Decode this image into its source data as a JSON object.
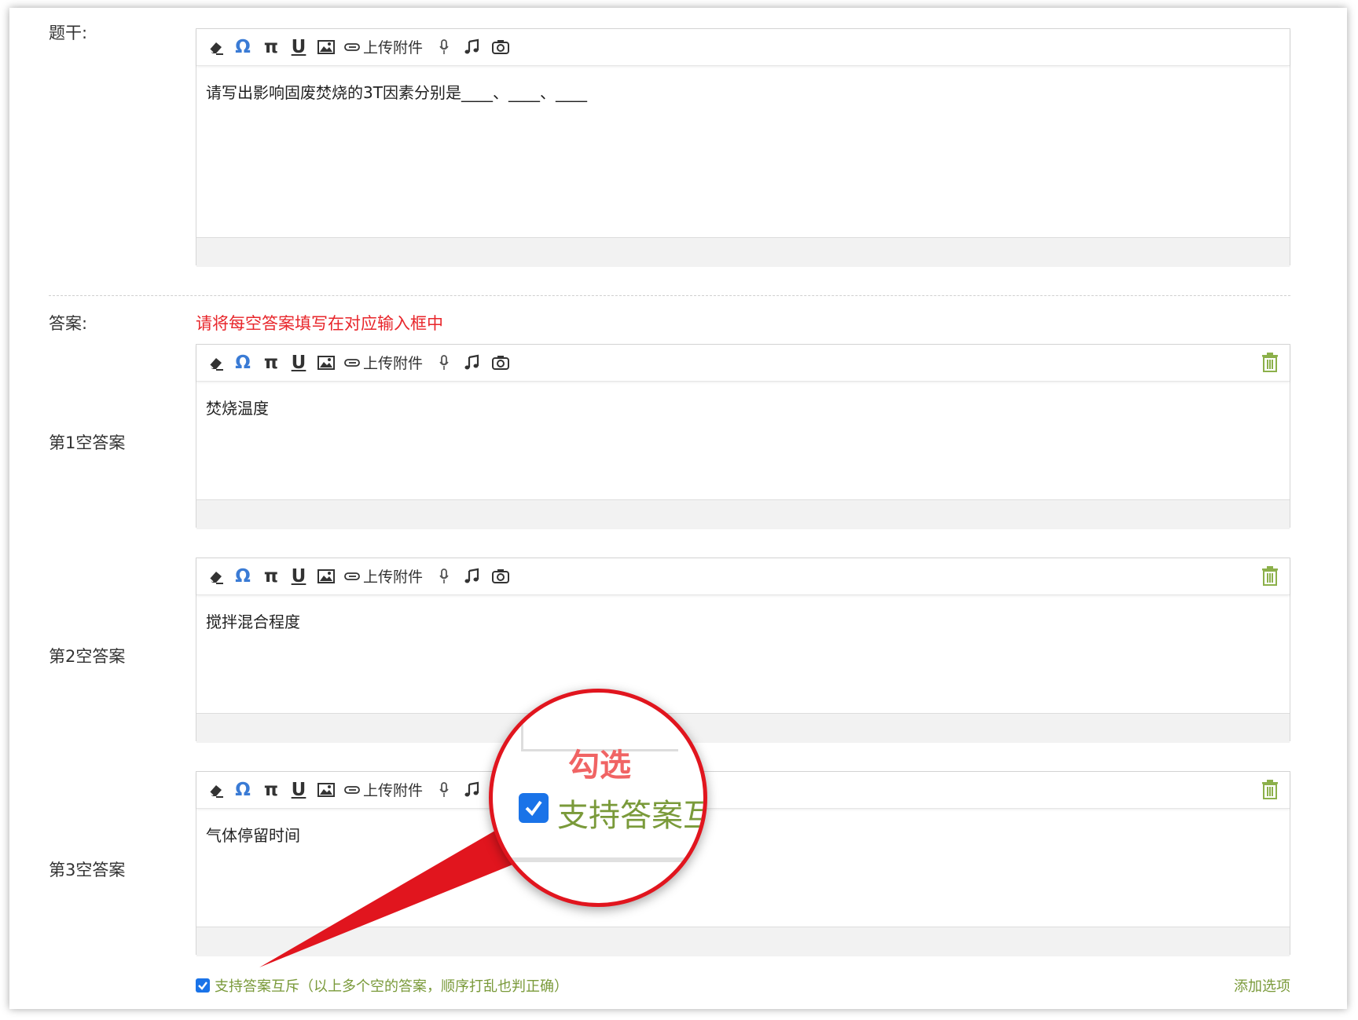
{
  "stem": {
    "label": "题干:",
    "content": "请写出影响固废焚烧的3T因素分别是____、____、____"
  },
  "toolbar": {
    "upload_label": "上传附件",
    "icons": [
      "eraser-icon",
      "omega-icon",
      "pi-icon",
      "underline-icon",
      "image-icon",
      "paperclip-icon",
      "microphone-icon",
      "music-note-icon",
      "camera-icon"
    ],
    "omega_glyph": "Ω",
    "pi_glyph": "π",
    "underline_glyph": "U"
  },
  "answer": {
    "label": "答案:",
    "hint": "请将每空答案填写在对应输入框中",
    "blanks": [
      {
        "label": "第1空答案",
        "content": "焚烧温度"
      },
      {
        "label": "第2空答案",
        "content": "搅拌混合程度"
      },
      {
        "label": "第3空答案",
        "content": "气体停留时间"
      }
    ]
  },
  "footer": {
    "mutual_exclusive_label": "支持答案互斥（以上多个空的答案，顺序打乱也判正确）",
    "mutual_exclusive_checked": true,
    "add_option_label": "添加选项"
  },
  "callout": {
    "title": "勾选",
    "text": "支持答案互",
    "accent_color": "#e1151e"
  },
  "colors": {
    "hint": "#e8262b",
    "green_text": "#7a9a3a",
    "checkbox": "#1a73e8",
    "trash": "#8cb04a"
  }
}
